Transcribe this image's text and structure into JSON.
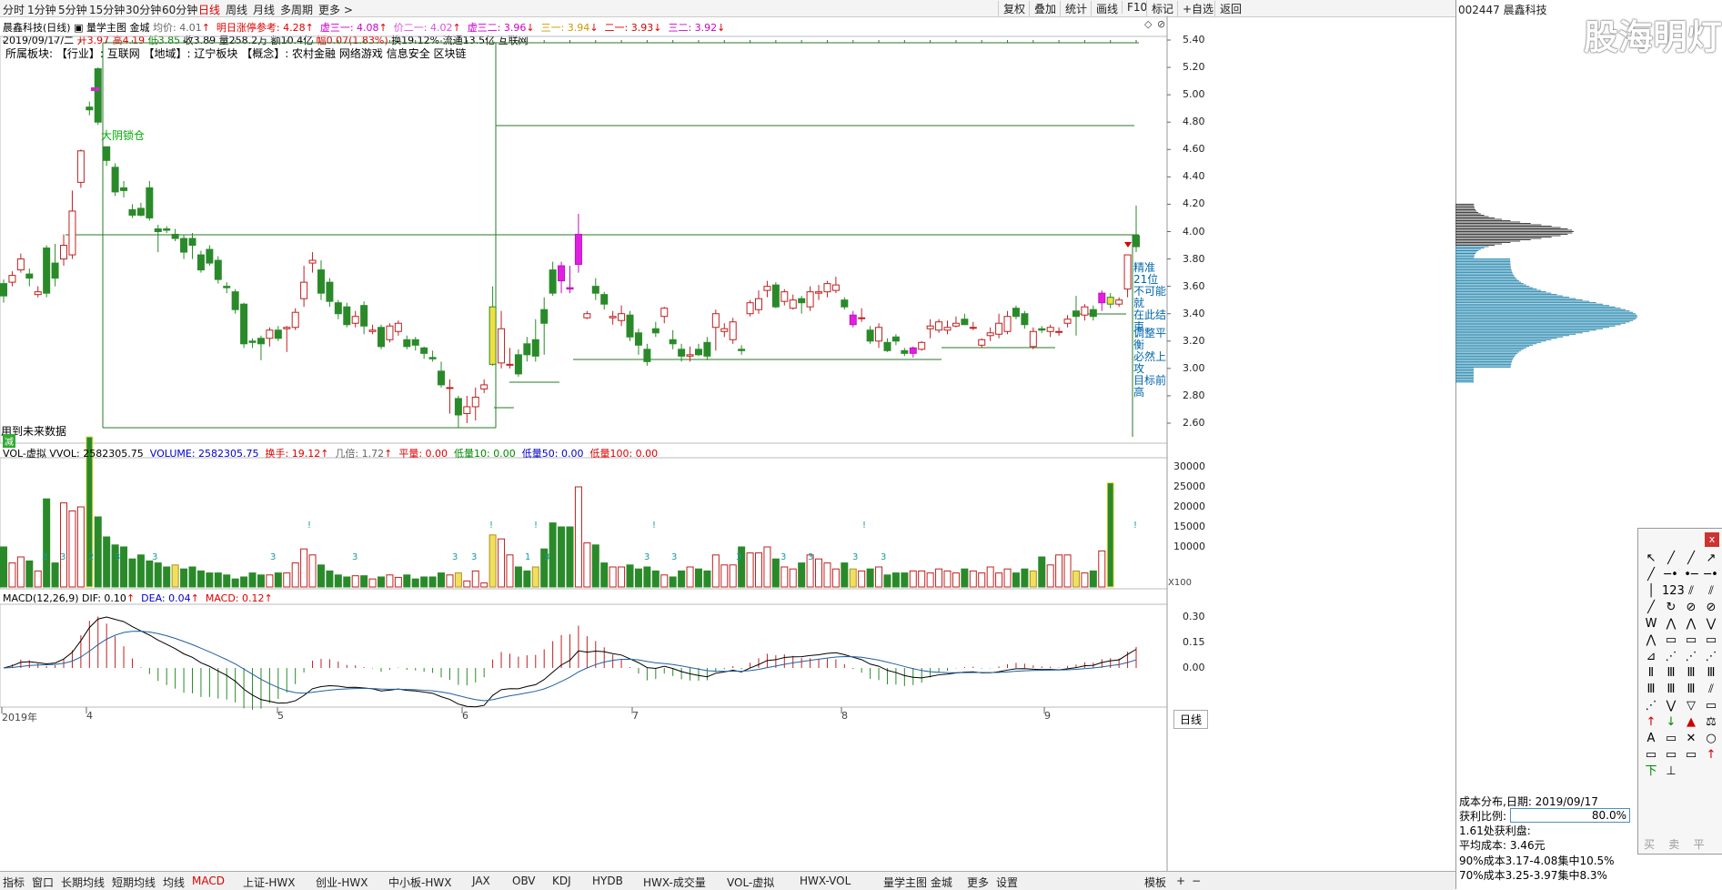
{
  "top_tabs": [
    "分时",
    "1分钟",
    "5分钟",
    "15分钟",
    "30分钟",
    "60分钟",
    "日线",
    "周线",
    "月线",
    "多周期",
    "更多 >"
  ],
  "active_tab": "日线",
  "right_buttons": [
    "复权",
    "叠加",
    "统计",
    "画线",
    "F10",
    "标记",
    "+自选",
    "返回"
  ],
  "stock_header": "002447 晨鑫科技",
  "watermark": "股海明灯",
  "info1": {
    "name": "晨鑫科技(日线)",
    "indicator": "量学主图 金城",
    "junjia": "均价: 4.01",
    "zhangting": "明日涨停参考: 4.28",
    "x31": "虚三一: 4.08",
    "j21": "价二一: 4.02",
    "x32": "虚三二: 3.96",
    "s1": "三一: 3.94",
    "e1": "二一: 3.93",
    "s2": "三二: 3.92"
  },
  "info2": {
    "date": "2019/09/17/二",
    "open": "开3.97",
    "high": "高4.19",
    "low": "低3.85",
    "close": "收3.89",
    "vol": "量258.2万",
    "amount": "额10.4亿",
    "change": "幅0.07(1.83%)",
    "turnover": "换19.12%",
    "float": "流通13.5亿",
    "sector": "互联网"
  },
  "info3": "所属板块:  【行业】: 互联网     【地域】: 辽宁板块     【概念】: 农村金融 网络游戏 信息安全 区块链",
  "annotations": {
    "dayin": "大阴锁仓",
    "future": "用到未来数据",
    "jingzhun": [
      "精准21位",
      "不可能就",
      "在此结束"
    ],
    "tiaozheng": [
      "调整平衡",
      "必然上攻",
      "目标前高"
    ],
    "ting": "减"
  },
  "price_axis": [
    "5.40",
    "5.20",
    "5.00",
    "4.80",
    "4.60",
    "4.40",
    "4.20",
    "4.00",
    "3.80",
    "3.60",
    "3.40",
    "3.20",
    "3.00",
    "2.80",
    "2.60"
  ],
  "vol_header": {
    "title": "VOL-虚拟",
    "vvol": "VVOL: 2582305.75",
    "volume": "VOLUME: 2582305.75",
    "huanshou": "换手: 19.12",
    "jibei": "几倍: 1.72",
    "pingliang": "平量: 0.00",
    "dl10": "低量10: 0.00",
    "dl50": "低量50: 0.00",
    "dl100": "低量100: 0.00"
  },
  "vol_axis": [
    "30000",
    "25000",
    "20000",
    "15000",
    "10000"
  ],
  "vol_unit": "X100",
  "macd_header": {
    "title": "MACD(12,26,9)",
    "dif": "DIF: 0.10",
    "dea": "DEA: 0.04",
    "macd": "MACD: 0.12"
  },
  "macd_axis": [
    "0.30",
    "0.15",
    "0.00"
  ],
  "time_axis": [
    "2019年",
    "4",
    "5",
    "6",
    "7",
    "8",
    "9"
  ],
  "bottom_tabs": [
    "指标",
    "窗口",
    "长期均线",
    "短期均线",
    "均线",
    "MACD",
    "上证-HWX",
    "创业-HWX",
    "中小板-HWX",
    "JAX",
    "OBV",
    "KDJ",
    "HYDB",
    "HWX-成交量",
    "VOL-虚拟",
    "HWX-VOL",
    "量学主图 金城",
    "更多",
    "设置"
  ],
  "active_bottom_tab": "MACD",
  "template_tab": "模板",
  "day_label": "日线",
  "cost": {
    "title": "成本分布,日期:  2019/09/17",
    "ratio_label": "获利比例:",
    "ratio_value": "80.0%",
    "profit": "1.61处获利盘:",
    "avg": "平均成本: 3.46元",
    "c90": "90%成本3.17-4.08集中10.5%",
    "c70": "70%成本3.25-3.97集中8.3%"
  },
  "toolbox_close": "x",
  "toolbox_bottom": [
    "买",
    "卖",
    "平"
  ],
  "chart_data": {
    "type": "candlestick",
    "candles": [
      [
        3.62,
        3.53,
        3.65,
        3.48
      ],
      [
        3.63,
        3.68,
        3.71,
        3.6
      ],
      [
        3.72,
        3.8,
        3.84,
        3.7
      ],
      [
        3.69,
        3.66,
        3.73,
        3.6
      ],
      [
        3.54,
        3.56,
        3.6,
        3.52
      ],
      [
        3.88,
        3.55,
        3.9,
        3.52
      ],
      [
        3.77,
        3.66,
        3.91,
        3.6
      ],
      [
        3.8,
        3.9,
        3.98,
        3.75
      ],
      [
        3.83,
        4.15,
        4.3,
        3.8
      ],
      [
        4.36,
        4.59,
        4.6,
        4.32
      ],
      [
        4.91,
        4.89,
        4.95,
        4.85
      ],
      [
        5.19,
        4.8,
        5.2,
        4.78
      ],
      [
        4.62,
        4.52,
        4.62,
        4.48
      ],
      [
        4.47,
        4.29,
        4.5,
        4.26
      ],
      [
        4.32,
        4.3,
        4.37,
        4.25
      ],
      [
        4.16,
        4.12,
        4.2,
        4.1
      ],
      [
        4.17,
        4.12,
        4.21,
        4.11
      ],
      [
        4.32,
        4.1,
        4.37,
        4.08
      ],
      [
        4.02,
        4.0,
        4.05,
        3.85
      ],
      [
        4.02,
        4.01,
        4.04,
        3.99
      ],
      [
        3.98,
        3.95,
        4.02,
        3.93
      ],
      [
        3.95,
        3.85,
        3.98,
        3.8
      ],
      [
        3.95,
        3.9,
        3.99,
        3.8
      ],
      [
        3.83,
        3.72,
        3.86,
        3.7
      ],
      [
        3.87,
        3.77,
        3.9,
        3.75
      ],
      [
        3.79,
        3.65,
        3.82,
        3.62
      ],
      [
        3.6,
        3.59,
        3.63,
        3.55
      ],
      [
        3.56,
        3.43,
        3.58,
        3.4
      ],
      [
        3.47,
        3.18,
        3.48,
        3.15
      ],
      [
        3.2,
        3.19,
        3.22,
        3.15
      ],
      [
        3.22,
        3.18,
        3.24,
        3.06
      ],
      [
        3.22,
        3.28,
        3.3,
        3.16
      ],
      [
        3.28,
        3.22,
        3.31,
        3.2
      ],
      [
        3.29,
        3.3,
        3.31,
        3.12
      ],
      [
        3.3,
        3.41,
        3.44,
        3.28
      ],
      [
        3.51,
        3.63,
        3.75,
        3.45
      ],
      [
        3.77,
        3.79,
        3.85,
        3.7
      ],
      [
        3.72,
        3.55,
        3.79,
        3.5
      ],
      [
        3.63,
        3.49,
        3.66,
        3.45
      ],
      [
        3.48,
        3.4,
        3.5,
        3.36
      ],
      [
        3.45,
        3.32,
        3.48,
        3.3
      ],
      [
        3.33,
        3.38,
        3.42,
        3.3
      ],
      [
        3.46,
        3.31,
        3.49,
        3.25
      ],
      [
        3.27,
        3.28,
        3.32,
        3.25
      ],
      [
        3.3,
        3.16,
        3.32,
        3.14
      ],
      [
        3.21,
        3.31,
        3.33,
        3.19
      ],
      [
        3.27,
        3.33,
        3.35,
        3.24
      ],
      [
        3.21,
        3.16,
        3.24,
        3.14
      ],
      [
        3.21,
        3.17,
        3.23,
        3.13
      ],
      [
        3.15,
        3.11,
        3.16,
        3.07
      ],
      [
        3.08,
        3.07,
        3.13,
        3.05
      ],
      [
        2.98,
        2.88,
        3.05,
        2.86
      ],
      [
        2.86,
        2.86,
        2.92,
        2.67
      ],
      [
        2.78,
        2.66,
        2.8,
        2.57
      ],
      [
        2.67,
        2.72,
        2.8,
        2.6
      ],
      [
        2.72,
        2.79,
        2.86,
        2.62
      ],
      [
        2.85,
        2.88,
        2.92,
        2.82
      ],
      [
        3.03,
        3.45,
        3.6,
        3.02
      ],
      [
        3.04,
        3.29,
        3.42,
        3.0
      ],
      [
        3.03,
        3.03,
        3.15,
        3.0
      ],
      [
        3.1,
        2.96,
        3.14,
        2.94
      ],
      [
        3.18,
        3.1,
        3.23,
        3.05
      ],
      [
        3.21,
        3.09,
        3.36,
        3.05
      ],
      [
        3.43,
        3.33,
        3.52,
        3.1
      ],
      [
        3.72,
        3.55,
        3.78,
        3.53
      ],
      [
        3.75,
        3.64,
        3.78,
        3.55
      ],
      [
        3.59,
        3.58,
        3.75,
        3.55
      ],
      [
        3.76,
        3.98,
        4.13,
        3.7
      ],
      [
        3.37,
        3.4,
        3.42,
        3.36
      ],
      [
        3.6,
        3.55,
        3.66,
        3.5
      ],
      [
        3.54,
        3.47,
        3.56,
        3.43
      ],
      [
        3.37,
        3.38,
        3.42,
        3.32
      ],
      [
        3.35,
        3.4,
        3.46,
        3.31
      ],
      [
        3.39,
        3.23,
        3.42,
        3.2
      ],
      [
        3.26,
        3.17,
        3.29,
        3.1
      ],
      [
        3.14,
        3.05,
        3.18,
        3.02
      ],
      [
        3.29,
        3.26,
        3.34,
        3.23
      ],
      [
        3.38,
        3.44,
        3.45,
        3.33
      ],
      [
        3.21,
        3.18,
        3.28,
        3.14
      ],
      [
        3.14,
        3.09,
        3.18,
        3.05
      ],
      [
        3.09,
        3.1,
        3.16,
        3.05
      ],
      [
        3.14,
        3.1,
        3.18,
        3.09
      ],
      [
        3.19,
        3.09,
        3.23,
        3.06
      ],
      [
        3.3,
        3.4,
        3.43,
        3.13
      ],
      [
        3.27,
        3.29,
        3.33,
        3.23
      ],
      [
        3.21,
        3.34,
        3.37,
        3.18
      ],
      [
        3.14,
        3.13,
        3.17,
        3.1
      ],
      [
        3.4,
        3.48,
        3.5,
        3.38
      ],
      [
        3.43,
        3.51,
        3.57,
        3.4
      ],
      [
        3.57,
        3.6,
        3.64,
        3.52
      ],
      [
        3.61,
        3.45,
        3.63,
        3.44
      ],
      [
        3.49,
        3.56,
        3.58,
        3.46
      ],
      [
        3.44,
        3.5,
        3.54,
        3.43
      ],
      [
        3.51,
        3.48,
        3.53,
        3.4
      ],
      [
        3.45,
        3.56,
        3.6,
        3.42
      ],
      [
        3.55,
        3.56,
        3.61,
        3.5
      ],
      [
        3.56,
        3.62,
        3.64,
        3.52
      ],
      [
        3.57,
        3.61,
        3.67,
        3.55
      ],
      [
        3.5,
        3.45,
        3.52,
        3.43
      ],
      [
        3.32,
        3.39,
        3.42,
        3.3
      ],
      [
        3.37,
        3.37,
        3.44,
        3.34
      ],
      [
        3.28,
        3.2,
        3.31,
        3.18
      ],
      [
        3.2,
        3.3,
        3.33,
        3.15
      ],
      [
        3.19,
        3.13,
        3.22,
        3.12
      ],
      [
        3.23,
        3.2,
        3.25,
        3.17
      ],
      [
        3.13,
        3.11,
        3.15,
        3.09
      ],
      [
        3.11,
        3.15,
        3.16,
        3.08
      ],
      [
        3.14,
        3.19,
        3.2,
        3.13
      ],
      [
        3.29,
        3.31,
        3.36,
        3.22
      ],
      [
        3.28,
        3.34,
        3.36,
        3.26
      ],
      [
        3.28,
        3.3,
        3.35,
        3.25
      ],
      [
        3.31,
        3.33,
        3.38,
        3.3
      ],
      [
        3.36,
        3.32,
        3.4,
        3.32
      ],
      [
        3.3,
        3.3,
        3.34,
        3.28
      ],
      [
        3.17,
        3.21,
        3.22,
        3.15
      ],
      [
        3.24,
        3.26,
        3.3,
        3.2
      ],
      [
        3.25,
        3.33,
        3.4,
        3.22
      ],
      [
        3.27,
        3.38,
        3.42,
        3.25
      ],
      [
        3.44,
        3.38,
        3.46,
        3.36
      ],
      [
        3.4,
        3.32,
        3.42,
        3.29
      ],
      [
        3.16,
        3.27,
        3.3,
        3.14
      ],
      [
        3.29,
        3.28,
        3.31,
        3.26
      ],
      [
        3.27,
        3.3,
        3.32,
        3.23
      ],
      [
        3.27,
        3.27,
        3.3,
        3.24
      ],
      [
        3.33,
        3.36,
        3.39,
        3.3
      ],
      [
        3.42,
        3.38,
        3.53,
        3.24
      ],
      [
        3.39,
        3.45,
        3.47,
        3.35
      ],
      [
        3.43,
        3.38,
        3.46,
        3.35
      ],
      [
        3.48,
        3.55,
        3.57,
        3.42
      ],
      [
        3.47,
        3.52,
        3.55,
        3.44
      ],
      [
        3.47,
        3.5,
        3.52,
        3.45
      ],
      [
        3.58,
        3.83,
        3.83,
        3.52
      ],
      [
        3.97,
        3.89,
        4.19,
        3.85
      ]
    ],
    "volume_approx_x100": [
      10000,
      6000,
      7500,
      6500,
      4000,
      22000,
      6000,
      21000,
      19000,
      20000,
      37500,
      17500,
      12500,
      10500,
      10000,
      7000,
      8000,
      6500,
      6000,
      5000,
      5500,
      4500,
      5000,
      4000,
      3500,
      3500,
      3000,
      2000,
      2500,
      3500,
      3000,
      3000,
      3500,
      3500,
      6000,
      9500,
      8000,
      5500,
      4000,
      3000,
      2500,
      2800,
      2800,
      2000,
      2500,
      3000,
      2400,
      3000,
      2000,
      2500,
      2500,
      3500,
      3000,
      3500,
      1500,
      4000,
      1000,
      13000,
      12000,
      8000,
      5000,
      4000,
      5000,
      9500,
      16000,
      15000,
      15000,
      25000,
      11000,
      10500,
      6000,
      5000,
      5000,
      5500,
      4500,
      5000,
      4000,
      3000,
      2500,
      4000,
      5000,
      4500,
      4000,
      8000,
      5500,
      5500,
      10000,
      8500,
      8500,
      10000,
      7000,
      5000,
      4500,
      6000,
      8000,
      7000,
      6000,
      4500,
      6000,
      4500,
      4000,
      4500,
      5000,
      3000,
      3500,
      3500,
      4000,
      4000,
      3500,
      4500,
      4000,
      3500,
      4500,
      4000,
      3500,
      5000,
      3500,
      4500,
      3500,
      4500,
      4000,
      7500,
      5500,
      8000,
      8000,
      4000,
      3500,
      4000,
      9000,
      26000
    ]
  }
}
